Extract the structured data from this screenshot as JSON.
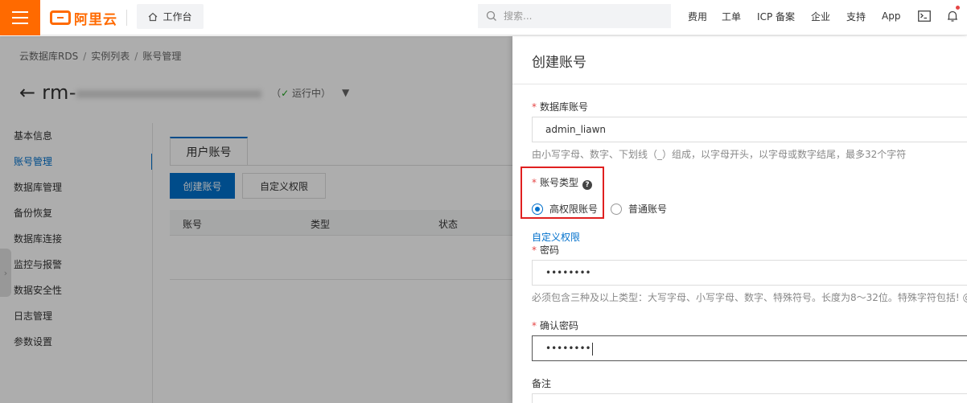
{
  "topbar": {
    "logo_text": "阿里云",
    "workbench_label": "工作台",
    "search_placeholder": "搜索...",
    "nav": [
      "费用",
      "工单",
      "ICP 备案",
      "企业",
      "支持",
      "App"
    ]
  },
  "page": {
    "breadcrumb": [
      "云数据库RDS",
      "实例列表",
      "账号管理"
    ],
    "instance_prefix": "rm-",
    "status": "运行中",
    "left_nav": [
      "基本信息",
      "账号管理",
      "数据库管理",
      "备份恢复",
      "数据库连接",
      "监控与报警",
      "数据安全性",
      "日志管理",
      "参数设置"
    ],
    "active_nav_index": 1,
    "tab_label": "用户账号",
    "create_button": "创建账号",
    "custom_perm_button": "自定义权限",
    "table_headers": [
      "账号",
      "类型",
      "状态"
    ]
  },
  "drawer": {
    "title": "创建账号",
    "account_label": "数据库账号",
    "account_value": "admin_liawn",
    "account_hint": "由小写字母、数字、下划线（_）组成，以字母开头，以字母或数字结尾，最多32个字符",
    "type_label": "账号类型",
    "type_options": [
      "高权限账号",
      "普通账号"
    ],
    "type_selected_index": 0,
    "custom_perm_link": "自定义权限",
    "password_label": "密码",
    "password_value": "••••••••",
    "password_hint": "必须包含三种及以上类型：大写字母、小写字母、数字、特殊符号。长度为8～32位。特殊字符包括! @",
    "confirm_label": "确认密码",
    "confirm_value": "••••••••",
    "remark_label": "备注"
  },
  "colors": {
    "brand": "#ff6a00",
    "primary": "#0070cc",
    "required": "#e54545",
    "highlight": "#e02020"
  }
}
